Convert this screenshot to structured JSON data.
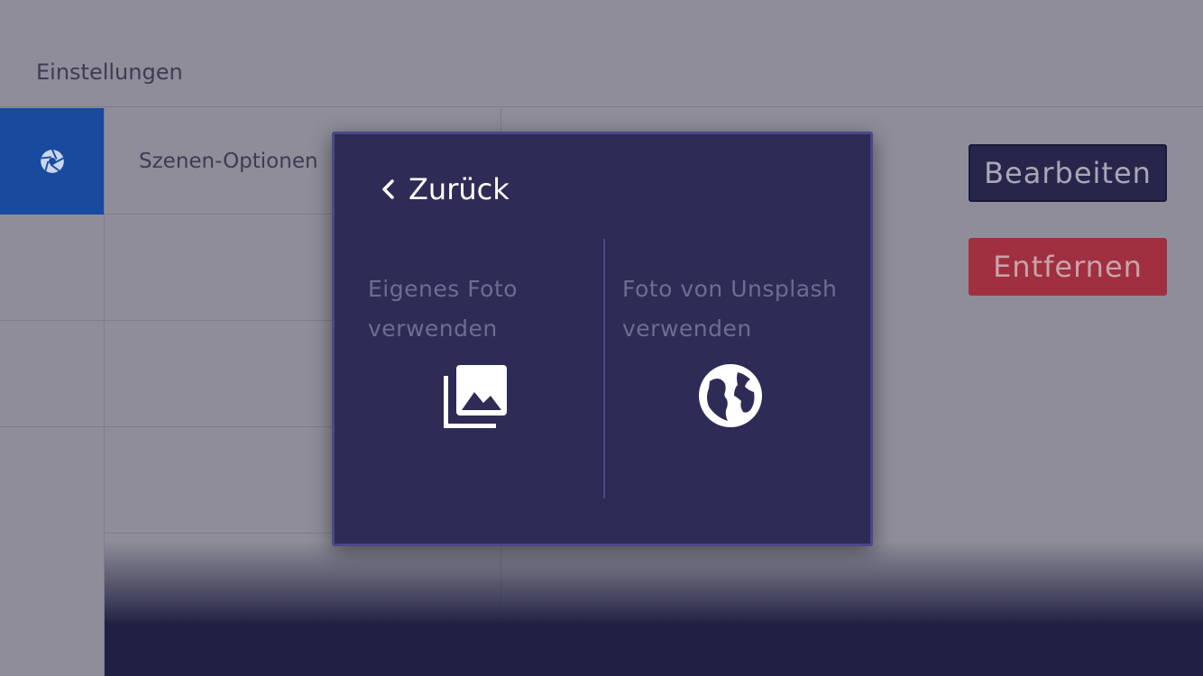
{
  "header": {
    "title": "Einstellungen"
  },
  "sidebar": {
    "items": [
      {
        "icon": "aperture-icon",
        "active": true
      },
      {
        "icon": ""
      },
      {
        "icon": ""
      }
    ]
  },
  "list": {
    "rows": [
      {
        "label": "Szenen-Optionen"
      }
    ]
  },
  "actions": {
    "edit_label": "Bearbeiten",
    "remove_label": "Entfernen"
  },
  "dialog": {
    "back_label": "Zurück",
    "options": [
      {
        "label": "Eigenes Foto verwenden",
        "icon": "photo-library-icon"
      },
      {
        "label": "Foto von Unsplash verwenden",
        "icon": "globe-icon"
      }
    ]
  },
  "colors": {
    "background": "#8e8d99",
    "sidebar_active": "#184a9e",
    "dialog_bg": "#2e2c56",
    "edit_button": "#27264a",
    "remove_button": "#a03040"
  }
}
